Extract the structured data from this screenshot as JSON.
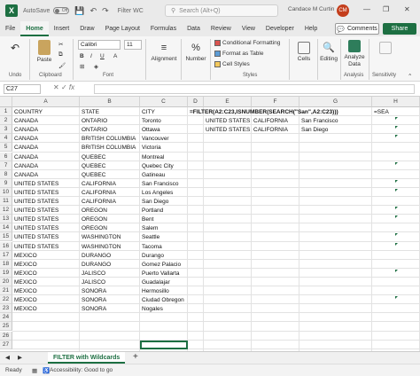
{
  "titlebar": {
    "autosave_label": "AutoSave",
    "autosave_state": "Off",
    "file_name": "Filter WC",
    "search_placeholder": "Search (Alt+Q)",
    "user_name": "Candace M Curtin",
    "user_initials": "CM",
    "minimize": "—",
    "restore": "❐",
    "close": "✕"
  },
  "menu_tabs": [
    "File",
    "Home",
    "Insert",
    "Draw",
    "Page Layout",
    "Formulas",
    "Data",
    "Review",
    "View",
    "Developer",
    "Help"
  ],
  "active_tab": "Home",
  "actions": {
    "comments": "Comments",
    "share": "Share"
  },
  "ribbon": {
    "undo_label": "Undo",
    "paste_label": "Paste",
    "clipboard_label": "Clipboard",
    "font_name": "Calibri",
    "font_size": "11",
    "font_label": "Font",
    "alignment_label": "Alignment",
    "number_label": "Number",
    "cond_format": "Conditional Formatting",
    "format_table": "Format as Table",
    "cell_styles": "Cell Styles",
    "styles_label": "Styles",
    "cells_label": "Cells",
    "editing_label": "Editing",
    "analyze_label": "Analyze Data",
    "analysis_label": "Analysis",
    "sensitivity_label": "Sensitivity",
    "bold": "B",
    "italic": "I",
    "underline": "U"
  },
  "formula_bar": {
    "name_box": "C27",
    "fx": "fx",
    "formula": ""
  },
  "columns": [
    "A",
    "B",
    "C",
    "D",
    "E",
    "F",
    "G",
    "H"
  ],
  "rows": [
    [
      "COUNTRY",
      "STATE",
      "CITY",
      "=FILTER(A2:C23,ISNUMBER(SEARCH(\"San\",A2:C23)))",
      "",
      "",
      "",
      "=SEA"
    ],
    [
      "CANADA",
      "ONTARIO",
      "Toronto",
      "",
      "UNITED STATES",
      "CALIFORNIA",
      "San Francisco",
      ""
    ],
    [
      "CANADA",
      "ONTARIO",
      "Ottawa",
      "",
      "UNITED STATES",
      "CALIFORNIA",
      "San Diego",
      ""
    ],
    [
      "CANADA",
      "BRITISH COLUMBIA",
      "Vancouver",
      "",
      "",
      "",
      "",
      ""
    ],
    [
      "CANADA",
      "BRITISH COLUMBIA",
      "Victoria",
      "",
      "",
      "",
      "",
      ""
    ],
    [
      "CANADA",
      "QUEBEC",
      "Montreal",
      "",
      "",
      "",
      "",
      ""
    ],
    [
      "CANADA",
      "QUEBEC",
      "Quebec City",
      "",
      "",
      "",
      "",
      ""
    ],
    [
      "CANADA",
      "QUEBEC",
      "Gatineau",
      "",
      "",
      "",
      "",
      ""
    ],
    [
      "UNITED STATES",
      "CALIFORNIA",
      "San Francisco",
      "",
      "",
      "",
      "",
      ""
    ],
    [
      "UNITED STATES",
      "CALIFORNIA",
      "Los Angeles",
      "",
      "",
      "",
      "",
      ""
    ],
    [
      "UNITED STATES",
      "CALIFORNIA",
      "San Diego",
      "",
      "",
      "",
      "",
      ""
    ],
    [
      "UNITED STATES",
      "OREGON",
      "Portland",
      "",
      "",
      "",
      "",
      ""
    ],
    [
      "UNITED STATES",
      "OREGON",
      "Bent",
      "",
      "",
      "",
      "",
      ""
    ],
    [
      "UNITED STATES",
      "OREGON",
      "Salem",
      "",
      "",
      "",
      "",
      ""
    ],
    [
      "UNITED STATES",
      "WASHINGTON",
      "Seattle",
      "",
      "",
      "",
      "",
      ""
    ],
    [
      "UNITED STATES",
      "WASHINGTON",
      "Tacoma",
      "",
      "",
      "",
      "",
      ""
    ],
    [
      "MEXICO",
      "DURANGO",
      "Durango",
      "",
      "",
      "",
      "",
      ""
    ],
    [
      "MEXICO",
      "DURANGO",
      "Gomez Palacio",
      "",
      "",
      "",
      "",
      ""
    ],
    [
      "MEXICO",
      "JALISCO",
      "Puerto Vallarta",
      "",
      "",
      "",
      "",
      ""
    ],
    [
      "MEXICO",
      "JALISCO",
      "Guadalajar",
      "",
      "",
      "",
      "",
      ""
    ],
    [
      "MEXICO",
      "SONORA",
      "Hermosillo",
      "",
      "",
      "",
      "",
      ""
    ],
    [
      "MEXICO",
      "SONORA",
      "Ciudad Obregon",
      "",
      "",
      "",
      "",
      ""
    ],
    [
      "MEXICO",
      "SONORA",
      "Nogales",
      "",
      "",
      "",
      "",
      ""
    ]
  ],
  "row_numbers": [
    "1",
    "2",
    "3",
    "4",
    "5",
    "6",
    "7",
    "8",
    "9",
    "10",
    "11",
    "12",
    "13",
    "14",
    "15",
    "16",
    "17",
    "18",
    "19",
    "20",
    "21",
    "22",
    "23",
    "24",
    "25",
    "26",
    "27"
  ],
  "sheet_tab": "FILTER with Wildcards",
  "add_sheet": "+",
  "status": {
    "ready": "Ready",
    "accessibility": "Accessibility: Good to go"
  },
  "colors": {
    "excel_green": "#1d6f42",
    "avatar": "#c43e1c"
  }
}
